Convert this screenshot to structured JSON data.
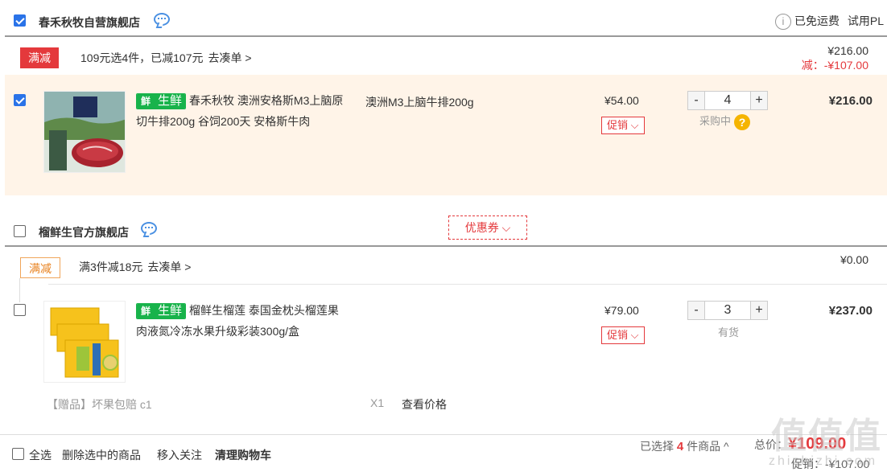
{
  "shop1": {
    "name": "春禾秋牧自营旗舰店",
    "checked": true,
    "shipping": "已免运费",
    "trial": "试用PL",
    "promo": {
      "tag": "满减",
      "text": "109元选4件，已减107元",
      "link": "去凑单 >",
      "total": "¥216.00",
      "discount": "减：-¥107.00"
    },
    "item": {
      "checked": true,
      "fresh_icon": "鲜",
      "fresh_label": "生鲜",
      "title": "春禾秋牧 澳洲安格斯M3上脑原切牛排200g 谷饲200天 安格斯牛肉",
      "spec": "澳洲M3上脑牛排200g",
      "unit_price": "¥54.00",
      "promo_btn": "促销",
      "qty": "4",
      "stock": "采购中",
      "help_icon": "?",
      "subtotal": "¥216.00"
    }
  },
  "shop2": {
    "name": "榴鲜生官方旗舰店",
    "checked": false,
    "coupon": "优惠券",
    "promo": {
      "tag": "满减",
      "text": "满3件减18元",
      "link": "去凑单 >",
      "total": "¥0.00"
    },
    "item": {
      "checked": false,
      "fresh_icon": "鲜",
      "fresh_label": "生鲜",
      "title": "榴鲜生榴莲 泰国金枕头榴莲果肉液氮冷冻水果升级彩装300g/盒",
      "unit_price": "¥79.00",
      "promo_btn": "促销",
      "qty": "3",
      "stock": "有货",
      "subtotal": "¥237.00"
    },
    "gift": {
      "label": "【赠品】坏果包赔 c1",
      "count": "X1",
      "link": "查看价格"
    }
  },
  "footer": {
    "select_all": "全选",
    "delete_selected": "删除选中的商品",
    "move_to_follow": "移入关注",
    "clear_cart": "清理购物车",
    "selected_prefix": "已选择",
    "selected_count": "4",
    "selected_suffix": "件商品 ^",
    "total_label": "总价：",
    "total_value": "¥109.00",
    "promo_label": "促销：",
    "promo_value": "-¥107.00"
  },
  "watermark": {
    "text": "值值值",
    "url": "zhizhizhi.com"
  },
  "colors": {
    "accent_red": "#e4393c",
    "checkbox_blue": "#2a73e8",
    "fresh_green": "#18b34b",
    "row_highlight": "#fff4e8"
  }
}
